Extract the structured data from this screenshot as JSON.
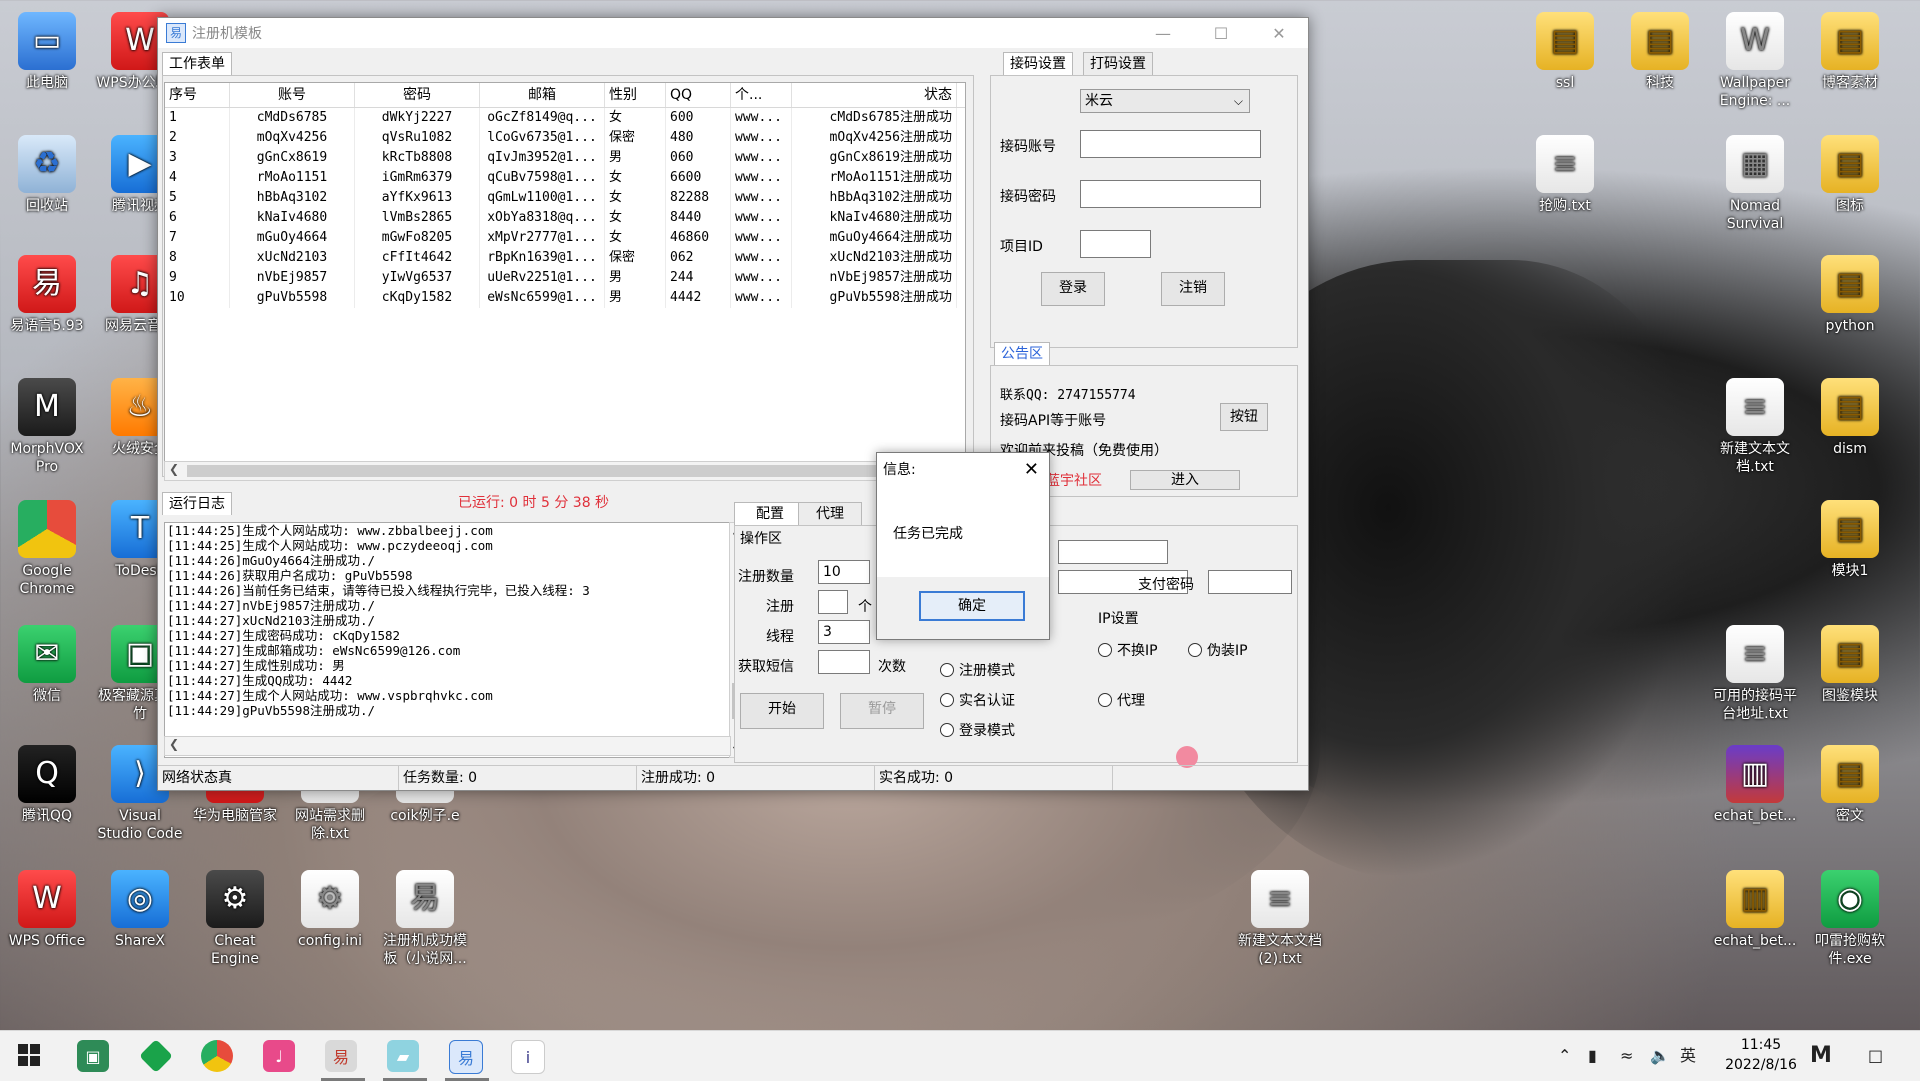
{
  "desktop": {
    "icons_left": [
      {
        "label": "此电脑",
        "icon": "computer-icon"
      },
      {
        "label": "WPS办公助手",
        "icon": "wps-icon"
      },
      {
        "label": "回收站",
        "icon": "recycle-bin-icon"
      },
      {
        "label": "腾讯视频",
        "icon": "tencent-video-icon"
      },
      {
        "label": "易语言5.93",
        "icon": "e-language-icon"
      },
      {
        "label": "网易云音乐",
        "icon": "netease-music-icon"
      },
      {
        "label": "MorphVOX Pro",
        "icon": "morphvox-icon"
      },
      {
        "label": "火绒安全",
        "icon": "huorong-icon"
      },
      {
        "label": "Google Chrome",
        "icon": "chrome-icon"
      },
      {
        "label": "ToDesk",
        "icon": "todesk-icon"
      },
      {
        "label": "微信",
        "icon": "wechat-icon"
      },
      {
        "label": "极客藏源真立竹",
        "icon": "geek-icon"
      },
      {
        "label": "腾讯QQ",
        "icon": "qq-icon"
      },
      {
        "label": "Visual Studio Code",
        "icon": "vscode-icon"
      },
      {
        "label": "华为电脑管家",
        "icon": "huawei-icon"
      },
      {
        "label": "网站需求删除.txt",
        "icon": "txt-file-icon"
      },
      {
        "label": "coik例子.e",
        "icon": "e-file-icon"
      },
      {
        "label": "WPS Office",
        "icon": "wps-office-icon"
      },
      {
        "label": "ShareX",
        "icon": "sharex-icon"
      },
      {
        "label": "Cheat Engine",
        "icon": "cheat-engine-icon"
      },
      {
        "label": "config.ini",
        "icon": "ini-file-icon"
      },
      {
        "label": "注册机成功模板（小说网...",
        "icon": "e-file-icon"
      }
    ],
    "icons_right": [
      {
        "label": "ssl",
        "icon": "folder-icon"
      },
      {
        "label": "科技",
        "icon": "folder-icon"
      },
      {
        "label": "Wallpaper Engine: ...",
        "icon": "wallpaper-engine-icon"
      },
      {
        "label": "博客素材",
        "icon": "folder-icon"
      },
      {
        "label": "抢购.txt",
        "icon": "txt-file-icon"
      },
      {
        "label": "Nomad Survival",
        "icon": "game-icon"
      },
      {
        "label": "图标",
        "icon": "folder-icon"
      },
      {
        "label": "python",
        "icon": "folder-icon"
      },
      {
        "label": "新建文本文档.txt",
        "icon": "txt-file-icon"
      },
      {
        "label": "dism",
        "icon": "folder-icon"
      },
      {
        "label": "模块1",
        "icon": "folder-icon"
      },
      {
        "label": "可用的接码平台地址.txt",
        "icon": "txt-file-icon"
      },
      {
        "label": "图鉴模块",
        "icon": "folder-icon"
      },
      {
        "label": "echat_bet...",
        "icon": "winrar-icon"
      },
      {
        "label": "密文",
        "icon": "folder-icon"
      },
      {
        "label": "echat_bet...",
        "icon": "archive-icon"
      },
      {
        "label": "叩雷抢购软件.exe",
        "icon": "exe-icon"
      },
      {
        "label": "新建文本文档(2).txt",
        "icon": "txt-file-icon"
      }
    ]
  },
  "window": {
    "title": "注册机模板",
    "tab_worksheet": "工作表单",
    "columns": [
      "序号",
      "账号",
      "密码",
      "邮箱",
      "性别",
      "QQ",
      "个...",
      "状态"
    ],
    "rows": [
      [
        "1",
        "cMdDs6785",
        "dWkYj2227",
        "oGcZf8149@q...",
        "女",
        "600",
        "www...",
        "cMdDs6785注册成功"
      ],
      [
        "2",
        "mOqXv4256",
        "qVsRu1082",
        "lCoGv6735@1...",
        "保密",
        "480",
        "www...",
        "mOqXv4256注册成功"
      ],
      [
        "3",
        "gGnCx8619",
        "kRcTb8808",
        "qIvJm3952@1...",
        "男",
        "060",
        "www...",
        "gGnCx8619注册成功"
      ],
      [
        "4",
        "rMoAo1151",
        "iGmRm6379",
        "qCuBv7598@1...",
        "女",
        "6600",
        "www...",
        "rMoAo1151注册成功"
      ],
      [
        "5",
        "hBbAq3102",
        "aYfKx9613",
        "qGmLw1100@1...",
        "女",
        "82288",
        "www...",
        "hBbAq3102注册成功"
      ],
      [
        "6",
        "kNaIv4680",
        "lVmBs2865",
        "xObYa8318@q...",
        "女",
        "8440",
        "www...",
        "kNaIv4680注册成功"
      ],
      [
        "7",
        "mGuOy4664",
        "mGwFo8205",
        "xMpVr2777@1...",
        "女",
        "46860",
        "www...",
        "mGuOy4664注册成功"
      ],
      [
        "8",
        "xUcNd2103",
        "cFfIt4642",
        "rBpKn1639@1...",
        "保密",
        "062",
        "www...",
        "xUcNd2103注册成功"
      ],
      [
        "9",
        "nVbEj9857",
        "yIwVg6537",
        "uUeRv2251@1...",
        "男",
        "244",
        "www...",
        "nVbEj9857注册成功"
      ],
      [
        "10",
        "gPuVb5598",
        "cKqDy1582",
        "eWsNc6599@1...",
        "男",
        "4442",
        "www...",
        "gPuVb5598注册成功"
      ]
    ],
    "right_tabs": [
      "接码设置",
      "打码设置"
    ],
    "platform_select": "米云",
    "label_account": "接码账号",
    "label_password": "接码密码",
    "label_project": "项目ID",
    "btn_login": "登录",
    "btn_logout": "注销",
    "notice_tab": "公告区",
    "notice_line1": "联系QQ: 2747155774",
    "notice_line2": "接码API等于账号",
    "notice_line3": "欢迎前来投稿（免费使用）",
    "notice_btn": "按钮",
    "notice_link": "蓝宇社区",
    "notice_enter": "进入",
    "log_tab": "运行日志",
    "runtime": "已运行: 0 时 5 分 38 秒",
    "log_lines": [
      "[11:44:25]生成个人网站成功: www.zbbalbeejj.com",
      "[11:44:25]生成个人网站成功: www.pczydeeoqj.com",
      "[11:44:26]mGuOy4664注册成功./",
      "[11:44:26]获取用户名成功: gPuVb5598",
      "[11:44:26]当前任务已结束，请等待已投入线程执行完毕，已投入线程: 3",
      "[11:44:27]nVbEj9857注册成功./",
      "[11:44:27]xUcNd2103注册成功./",
      "[11:44:27]生成密码成功: cKqDy1582",
      "[11:44:27]生成邮箱成功: eWsNc6599@126.com",
      "[11:44:27]生成性别成功: 男",
      "[11:44:27]生成QQ成功: 4442",
      "[11:44:27]生成个人网站成功: www.vspbrqhvkc.com",
      "[11:44:29]gPuVb5598注册成功./"
    ],
    "config_tabs": [
      "配置",
      "代理"
    ],
    "op_area": "操作区",
    "label_reg_count": "注册数量",
    "reg_count": "10",
    "label_reg": "注册",
    "label_unit": "个",
    "label_threads": "线程",
    "threads": "3",
    "label_sms": "获取短信",
    "label_times": "次数",
    "btn_start": "开始",
    "btn_pause": "暂停",
    "label_pay_password": "支付密码",
    "mode_reg": "注册模式",
    "mode_realname": "实名认证",
    "mode_login": "登录模式",
    "ip_settings": "IP设置",
    "ip_none": "不换IP",
    "ip_fake": "伪装IP",
    "ip_proxy": "代理",
    "status": {
      "network": "网络状态真",
      "tasks": "任务数量: 0",
      "reg_success": "注册成功: 0",
      "realname_success": "实名成功: 0"
    }
  },
  "dialog": {
    "title": "信息:",
    "message": "任务已完成",
    "ok": "确定"
  },
  "taskbar": {
    "ime": "英",
    "time": "11:45",
    "date": "2022/8/16"
  }
}
